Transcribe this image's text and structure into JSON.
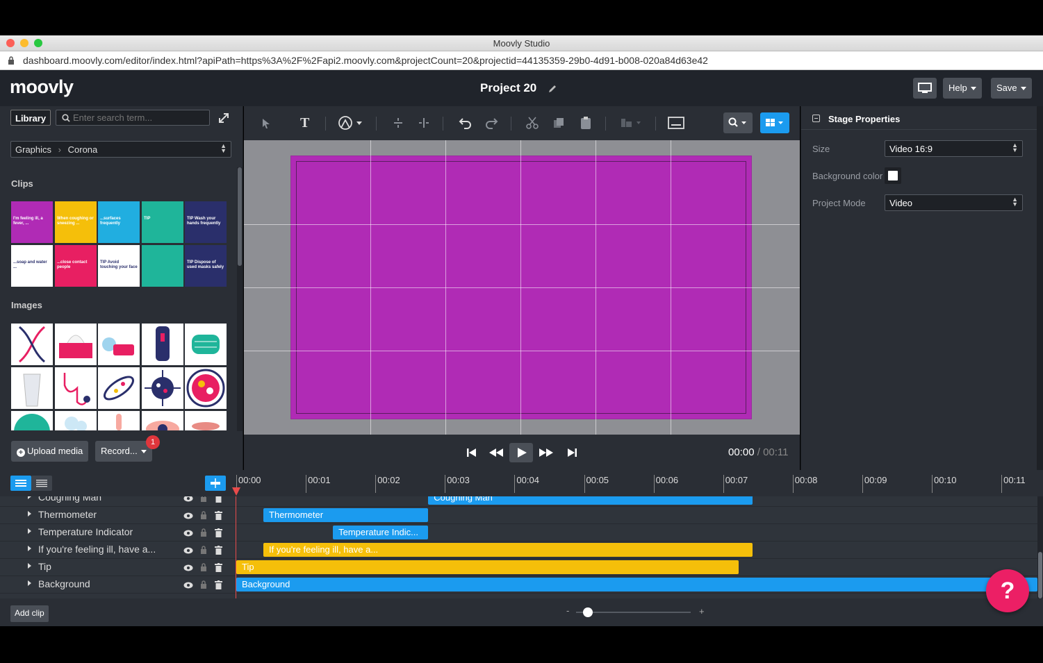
{
  "window": {
    "title": "Moovly Studio"
  },
  "browser": {
    "url": "dashboard.moovly.com/editor/index.html?apiPath=https%3A%2F%2Fapi2.moovly.com&projectCount=20&projectid=44135359-29b0-4d91-b008-020a84d63e42"
  },
  "header": {
    "logo": "moovly",
    "project_title": "Project 20",
    "help_label": "Help",
    "save_label": "Save"
  },
  "library": {
    "tab_label": "Library",
    "search_placeholder": "Enter search term...",
    "breadcrumb_root": "Graphics",
    "breadcrumb_current": "Corona",
    "clips_heading": "Clips",
    "images_heading": "Images",
    "clip_thumbs": [
      {
        "bg": "#b02bb5",
        "text": "I'm feeling ill, a fever, ..."
      },
      {
        "bg": "#f5bf0a",
        "text": "When coughing or sneezing ..."
      },
      {
        "bg": "#21aee0",
        "text": "...surfaces frequently"
      },
      {
        "bg": "#1fb59a",
        "text": "TIP"
      },
      {
        "bg": "#2a2f6b",
        "text": "TIP Wash your hands frequently"
      },
      {
        "bg": "#ffffff",
        "text": "...soap and water ..."
      },
      {
        "bg": "#e81f62",
        "text": "...close contact people"
      },
      {
        "bg": "#ffffff",
        "text": "TIP Avoid touching your face"
      },
      {
        "bg": "#1fb59a",
        "text": ""
      },
      {
        "bg": "#2a2f6b",
        "text": "TIP Dispose of used masks safely"
      }
    ],
    "upload_label": "Upload media",
    "record_label": "Record...",
    "record_badge": "1"
  },
  "stage": {
    "background_color": "#b02bb5"
  },
  "playback": {
    "current_time": "00:00",
    "separator": "/",
    "total_time": "00:11"
  },
  "properties": {
    "title": "Stage Properties",
    "size_label": "Size",
    "size_value": "Video 16:9",
    "bgcolor_label": "Background color",
    "bgcolor_value": "#ffffff",
    "mode_label": "Project Mode",
    "mode_value": "Video"
  },
  "timeline": {
    "ticks": [
      "00:00",
      "00:01",
      "00:02",
      "00:03",
      "00:04",
      "00:05",
      "00:06",
      "00:07",
      "00:08",
      "00:09",
      "00:10",
      "00:11"
    ],
    "tracks": [
      {
        "name": "Coughing Man",
        "bar_label": "Coughing Man",
        "start": 2.76,
        "end": 7.42,
        "color": "blue"
      },
      {
        "name": "Thermometer",
        "bar_label": "Thermometer",
        "start": 0.39,
        "end": 2.76,
        "color": "blue"
      },
      {
        "name": "Temperature Indicator",
        "bar_label": "Temperature Indic...",
        "start": 1.39,
        "end": 2.76,
        "color": "blue"
      },
      {
        "name": "If you're feeling ill, have a...",
        "bar_label": "If you're feeling ill, have a...",
        "start": 0.39,
        "end": 7.42,
        "color": "yellow"
      },
      {
        "name": "Tip",
        "bar_label": "Tip",
        "start": 0.0,
        "end": 7.22,
        "color": "yellow"
      },
      {
        "name": "Background",
        "bar_label": "Background",
        "start": 0.0,
        "end": 11.6,
        "color": "blue"
      }
    ],
    "add_clip_label": "Add clip",
    "zoom_minus": "-",
    "zoom_plus": "+",
    "zoom_level": 0.1
  },
  "help_fab": "?"
}
